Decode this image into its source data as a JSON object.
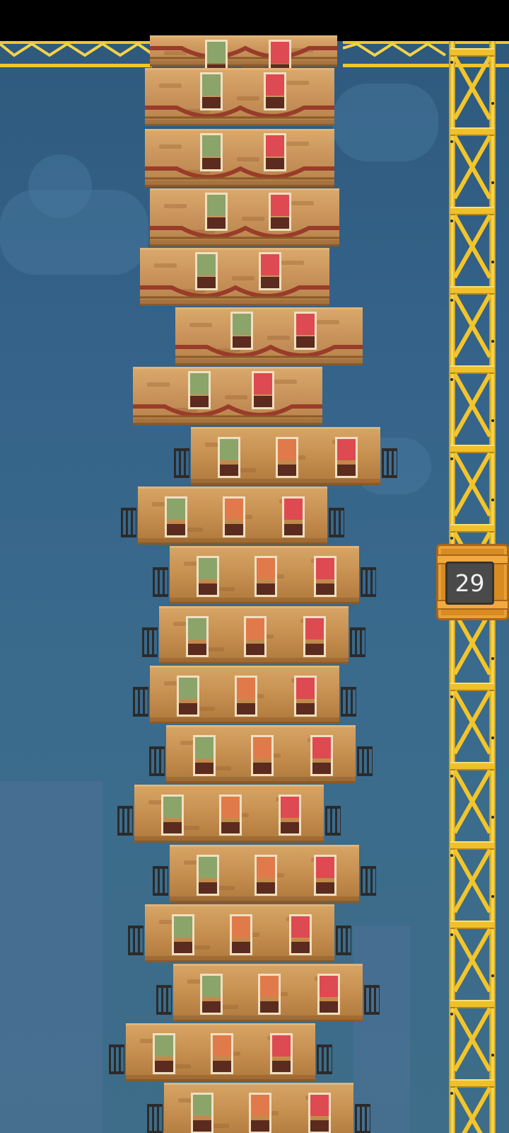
{
  "game": {
    "floor_count": "29"
  },
  "colors": {
    "crane_yellow": "#f3c52a",
    "counter_orange": "#d78b21",
    "window_green": "#8aa46a",
    "window_orange": "#e07a4a",
    "window_red": "#dd4a52"
  },
  "floors_visible": 20
}
